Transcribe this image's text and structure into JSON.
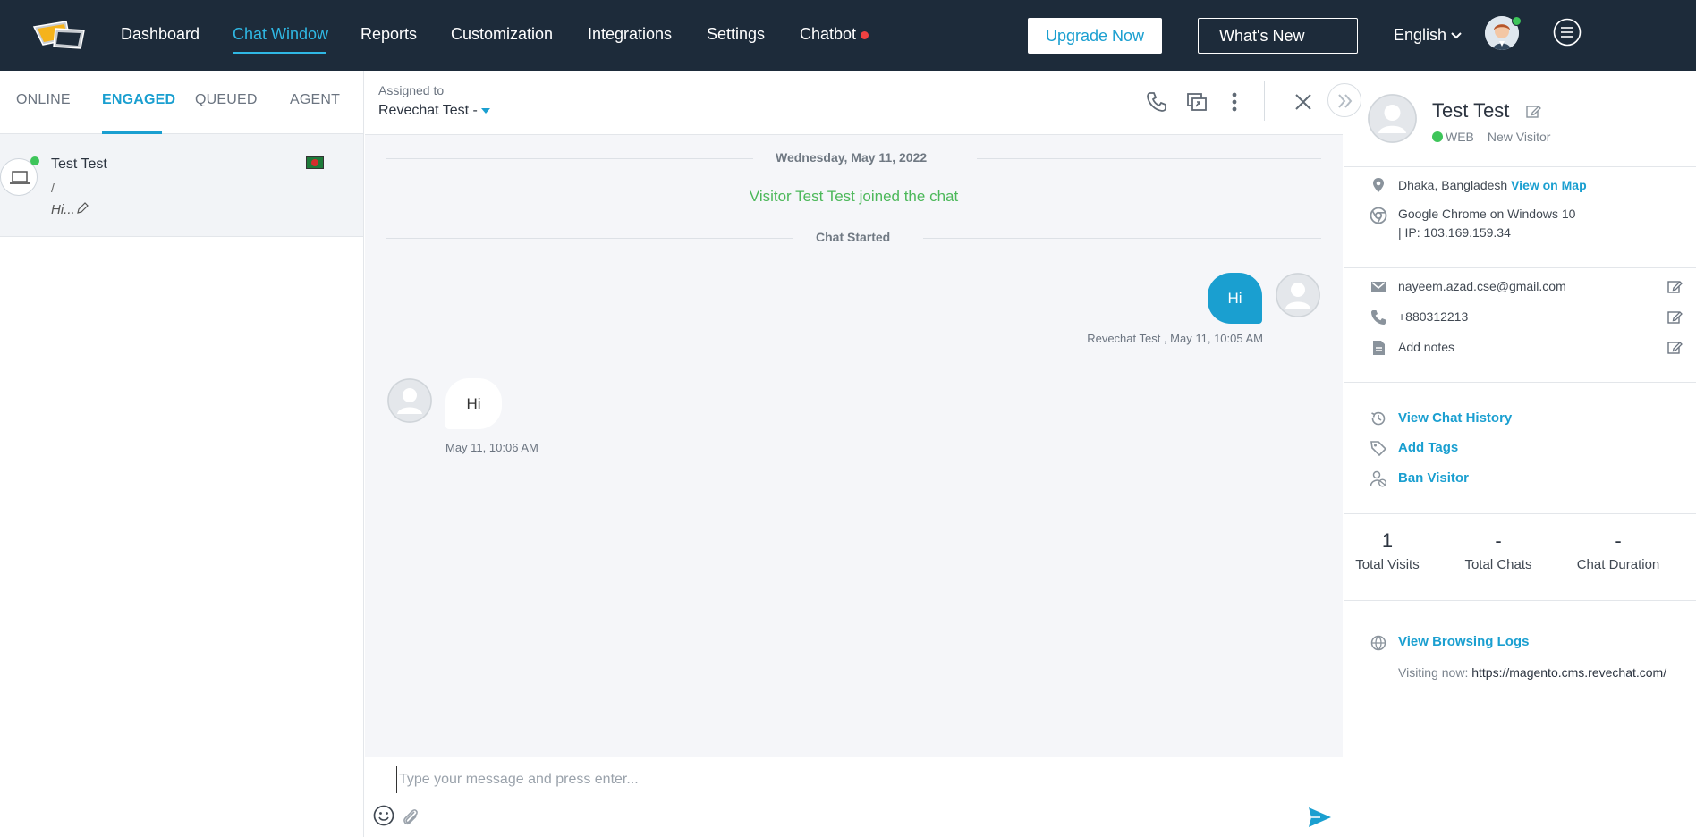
{
  "nav": {
    "items": [
      {
        "label": "Dashboard"
      },
      {
        "label": "Chat Window",
        "active": true
      },
      {
        "label": "Reports"
      },
      {
        "label": "Customization"
      },
      {
        "label": "Integrations"
      },
      {
        "label": "Settings"
      },
      {
        "label": "Chatbot",
        "badge": "red-dot"
      }
    ],
    "upgrade_label": "Upgrade Now",
    "whats_new_label": "What's New",
    "language": "English",
    "accent_color": "#2fb8e4",
    "background_color": "#1d2b3a"
  },
  "left": {
    "tabs": [
      {
        "label": "ONLINE"
      },
      {
        "label": "ENGAGED",
        "active": true
      },
      {
        "label": "QUEUED"
      },
      {
        "label": "AGENT"
      }
    ],
    "conversations": [
      {
        "name": "Test Test",
        "subtitle": "/",
        "last_message": "Hi...",
        "status": "online",
        "icon": "laptop-icon",
        "flag": "bangladesh-flag-icon"
      }
    ]
  },
  "chat": {
    "assigned_label": "Assigned to",
    "assigned_value": "Revechat Test -",
    "date_separator": "Wednesday, May 11, 2022",
    "joined_text": "Visitor Test Test joined the chat",
    "started_text": "Chat Started",
    "messages": [
      {
        "from": "agent",
        "text": "Hi",
        "meta": "Revechat Test , May 11, 10:05 AM"
      },
      {
        "from": "visitor",
        "text": "Hi",
        "meta": "May 11, 10:06 AM"
      }
    ],
    "input_placeholder": "Type your message and press enter...",
    "accent_color": "#1a9fd0"
  },
  "visitor": {
    "name": "Test Test",
    "channel": "WEB",
    "visitor_type": "New Visitor",
    "location": "Dhaka, Bangladesh",
    "view_on_map": "View on Map",
    "browser": "Google Chrome on Windows 10",
    "ip": "| IP: 103.169.159.34",
    "email": "nayeem.azad.cse@gmail.com",
    "phone": "+880312213",
    "notes_label": "Add notes",
    "actions": {
      "history": "View Chat History",
      "tags": "Add Tags",
      "ban": "Ban Visitor"
    },
    "stats": [
      {
        "value": "1",
        "label": "Total Visits"
      },
      {
        "value": "-",
        "label": "Total Chats"
      },
      {
        "value": "-",
        "label": "Chat Duration"
      }
    ],
    "browsing_logs_label": "View Browsing Logs",
    "visiting_label": "Visiting now:",
    "visiting_url": "https://magento.cms.revechat.com/"
  }
}
